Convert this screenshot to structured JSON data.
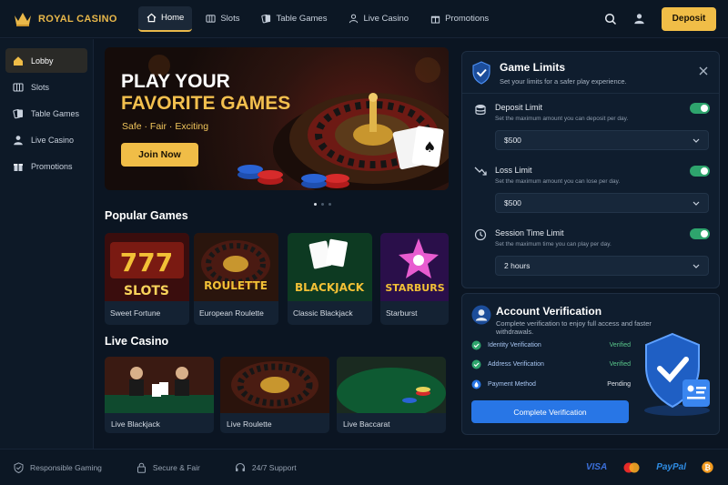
{
  "brand": {
    "name": "ROYAL CASINO",
    "accent": "#F0BD47"
  },
  "nav": [
    {
      "label": "Home",
      "icon": "home-icon",
      "active": true
    },
    {
      "label": "Slots",
      "icon": "slots-icon"
    },
    {
      "label": "Table Games",
      "icon": "cards-icon"
    },
    {
      "label": "Live Casino",
      "icon": "person-icon"
    },
    {
      "label": "Promotions",
      "icon": "gift-icon"
    }
  ],
  "header": {
    "deposit_label": "Deposit"
  },
  "sidebar": [
    {
      "label": "Lobby",
      "icon": "home-icon",
      "active": true
    },
    {
      "label": "Slots",
      "icon": "slots-icon"
    },
    {
      "label": "Table Games",
      "icon": "cards-icon"
    },
    {
      "label": "Live Casino",
      "icon": "person-icon"
    },
    {
      "label": "Promotions",
      "icon": "gift-icon"
    }
  ],
  "hero": {
    "title_line1": "PLAY YOUR",
    "title_line2": "FAVORITE GAMES",
    "subtitle": "Safe · Fair · Exciting",
    "cta": "Join Now",
    "slides_total": 3,
    "slide_active": 1
  },
  "popular": {
    "title": "Popular Games",
    "games": [
      {
        "name": "Sweet Fortune",
        "art_text": "SLOTS"
      },
      {
        "name": "European Roulette",
        "art_text": "ROULETTE"
      },
      {
        "name": "Classic Blackjack",
        "art_text": "BLACKJACK"
      },
      {
        "name": "Starburst",
        "art_text": "STARBURS"
      }
    ]
  },
  "live": {
    "title": "Live Casino",
    "games": [
      {
        "name": "Live Blackjack"
      },
      {
        "name": "Live Roulette"
      },
      {
        "name": "Live Baccarat"
      }
    ]
  },
  "limits": {
    "title": "Game Limits",
    "subtitle": "Set your limits for a safer play experience.",
    "items": [
      {
        "label": "Deposit Limit",
        "desc": "Set the maximum amount you can deposit per day.",
        "value": "$500",
        "enabled": true,
        "icon": "coins-icon"
      },
      {
        "label": "Loss Limit",
        "desc": "Set the maximum amount you can lose per day.",
        "value": "$500",
        "enabled": true,
        "icon": "trend-down-icon"
      },
      {
        "label": "Session Time Limit",
        "desc": "Set the maximum time you can play per day.",
        "value": "2 hours",
        "enabled": true,
        "icon": "clock-icon"
      }
    ]
  },
  "verification": {
    "title": "Account Verification",
    "subtitle": "Complete verification to enjoy full access and faster withdrawals.",
    "items": [
      {
        "label": "Identity Verification",
        "status": "Verified"
      },
      {
        "label": "Address Verification",
        "status": "Verified"
      },
      {
        "label": "Payment Method",
        "status": "Pending"
      }
    ],
    "cta": "Complete Verification"
  },
  "footer": {
    "items": [
      {
        "label": "Responsible Gaming",
        "icon": "shield-icon"
      },
      {
        "label": "Secure & Fair",
        "icon": "lock-icon"
      },
      {
        "label": "24/7 Support",
        "icon": "headset-icon"
      }
    ],
    "payments": [
      "VISA",
      "PayPal"
    ]
  }
}
